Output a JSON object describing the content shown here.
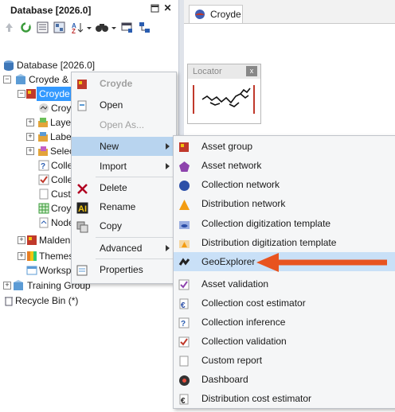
{
  "panel": {
    "title": "Database [2026.0]"
  },
  "tree": {
    "root": "Database [2026.0]",
    "croyde_group": "Croyde & N",
    "croyde_selected": "Croyde",
    "croyde_child1": "Croy",
    "layers": "Layer",
    "labels": "Label",
    "selections": "Selec",
    "collection1": "Colle",
    "collection2": "Colle",
    "custom": "Custo",
    "croyde_grid": "Croy",
    "node": "Node",
    "malden": "Malden",
    "themes": "Themes",
    "workspace": "Worksp",
    "training_group": "Training Group",
    "recycle_bin": "Recycle Bin (*)"
  },
  "document_tab": {
    "label": "Croyde"
  },
  "locator": {
    "title": "Locator",
    "close": "x"
  },
  "context_menu": {
    "header": "Croyde",
    "items": [
      {
        "label": "Open"
      },
      {
        "label": "Open As..."
      },
      {
        "label": "New"
      },
      {
        "label": "Import"
      },
      {
        "label": "Delete"
      },
      {
        "label": "Rename"
      },
      {
        "label": "Copy"
      },
      {
        "label": "Advanced"
      },
      {
        "label": "Properties"
      }
    ]
  },
  "new_submenu": {
    "items": [
      {
        "label": "Asset group"
      },
      {
        "label": "Asset network"
      },
      {
        "label": "Collection network"
      },
      {
        "label": "Distribution network"
      },
      {
        "label": "Collection digitization template"
      },
      {
        "label": "Distribution digitization template"
      },
      {
        "label": "GeoExplorer"
      },
      {
        "label": "Asset validation"
      },
      {
        "label": "Collection cost estimator"
      },
      {
        "label": "Collection inference"
      },
      {
        "label": "Collection validation"
      },
      {
        "label": "Custom report"
      },
      {
        "label": "Dashboard"
      },
      {
        "label": "Distribution cost estimator"
      }
    ]
  },
  "colors": {
    "highlight": "#c9e0f7",
    "selected_node": "#3399ff",
    "callout": "#e8531f"
  }
}
